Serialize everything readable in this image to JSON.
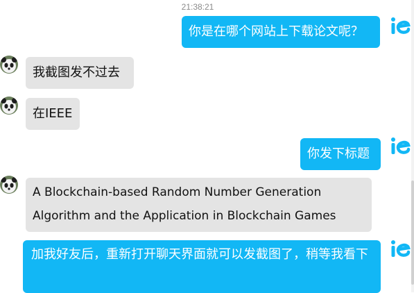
{
  "timestamp": "21:38:21",
  "messages": [
    {
      "direction": "out",
      "text": "你是在哪个网站上下载论文呢？"
    },
    {
      "direction": "in",
      "text": "我截图发不过去"
    },
    {
      "direction": "in",
      "text": "在IEEE"
    },
    {
      "direction": "out",
      "text": "你发下标题"
    },
    {
      "direction": "in",
      "text": "A Blockchain-based Random Number Generation Algorithm and the Application in Blockchain Games"
    },
    {
      "direction": "out",
      "text": "加我好友后，重新打开聊天界面就可以发截图了，稍等我看下"
    }
  ],
  "self_avatar": {
    "icon": "brand-logo-icon",
    "color": "#12b7f5"
  },
  "peer_avatar": {
    "icon": "panda-icon"
  },
  "colors": {
    "outgoing_bubble": "#12b7f5",
    "incoming_bubble": "#e4e4e4",
    "timestamp": "#8a8a8a"
  }
}
